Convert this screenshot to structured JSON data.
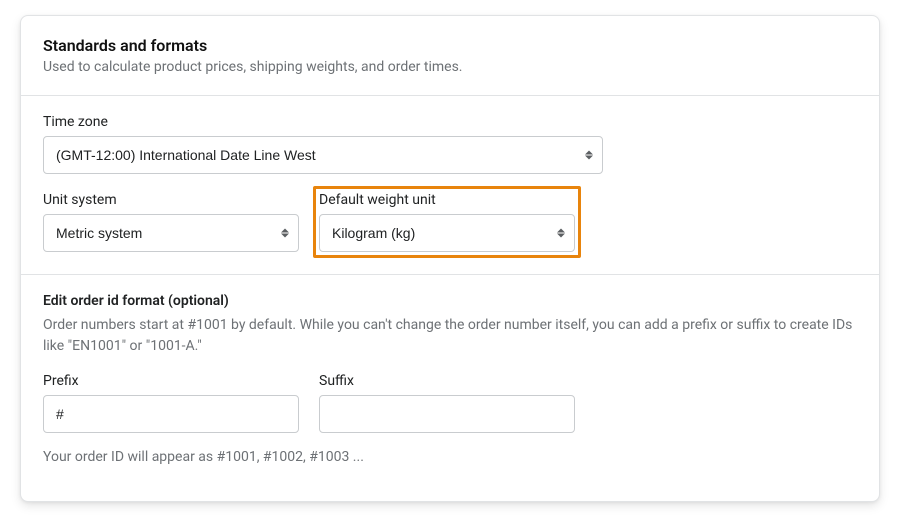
{
  "header": {
    "title": "Standards and formats",
    "subtitle": "Used to calculate product prices, shipping weights, and order times."
  },
  "timezone": {
    "label": "Time zone",
    "value": "(GMT-12:00) International Date Line West"
  },
  "unit_system": {
    "label": "Unit system",
    "value": "Metric system"
  },
  "default_weight_unit": {
    "label": "Default weight unit",
    "value": "Kilogram (kg)"
  },
  "order_id_format": {
    "title": "Edit order id format (optional)",
    "description": "Order numbers start at #1001 by default. While you can't change the order number itself, you can add a prefix or suffix to create IDs like \"EN1001\" or \"1001-A.\"",
    "prefix_label": "Prefix",
    "prefix_value": "#",
    "suffix_label": "Suffix",
    "suffix_value": "",
    "preview": "Your order ID will appear as #1001, #1002, #1003 ..."
  },
  "highlight_color": "#e8840c"
}
